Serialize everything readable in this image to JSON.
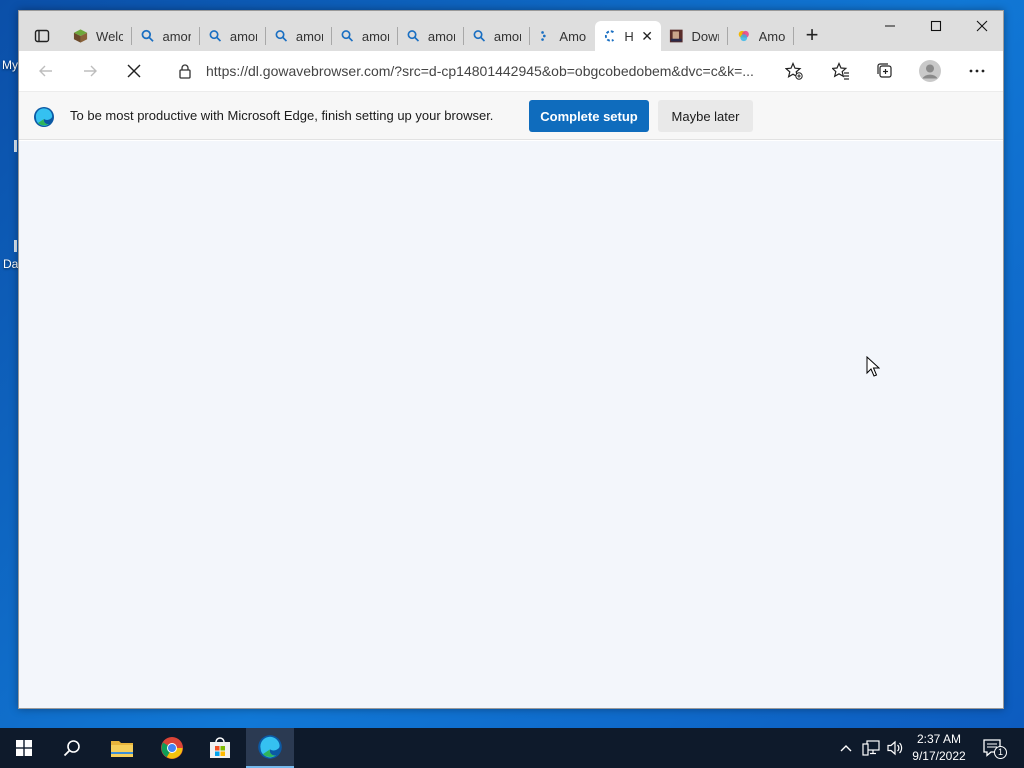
{
  "desktop": {
    "icon_labels": [
      "My",
      "Da"
    ]
  },
  "browser": {
    "tabs": [
      {
        "title": "Welc",
        "icon": "minecraft-icon"
      },
      {
        "title": "amor",
        "icon": "search-icon"
      },
      {
        "title": "amor",
        "icon": "search-icon"
      },
      {
        "title": "amor",
        "icon": "search-icon"
      },
      {
        "title": "amor",
        "icon": "search-icon"
      },
      {
        "title": "amor",
        "icon": "search-icon"
      },
      {
        "title": "amor",
        "icon": "search-icon"
      },
      {
        "title": "Amor",
        "icon": "loading-icon"
      },
      {
        "title": "H",
        "icon": "loading-icon",
        "active": true
      },
      {
        "title": "Dowr",
        "icon": "thumbnail-icon"
      },
      {
        "title": "Amor",
        "icon": "colorful-app-icon"
      }
    ],
    "url": "https://dl.gowavebrowser.com/?src=d-cp14801442945&ob=obgcobedobem&dvc=c&k=...",
    "infobar": {
      "message": "To be most productive with Microsoft Edge, finish setting up your browser.",
      "primary_label": "Complete setup",
      "secondary_label": "Maybe later"
    }
  },
  "taskbar": {
    "apps": [
      "start-icon",
      "search-icon",
      "file-explorer-icon",
      "chrome-icon",
      "store-icon",
      "edge-icon"
    ],
    "time": "2:37 AM",
    "date": "9/17/2022",
    "notification_count": "1"
  },
  "colors": {
    "accent": "#0f6cbd",
    "taskbar": "#0e1a2b"
  }
}
